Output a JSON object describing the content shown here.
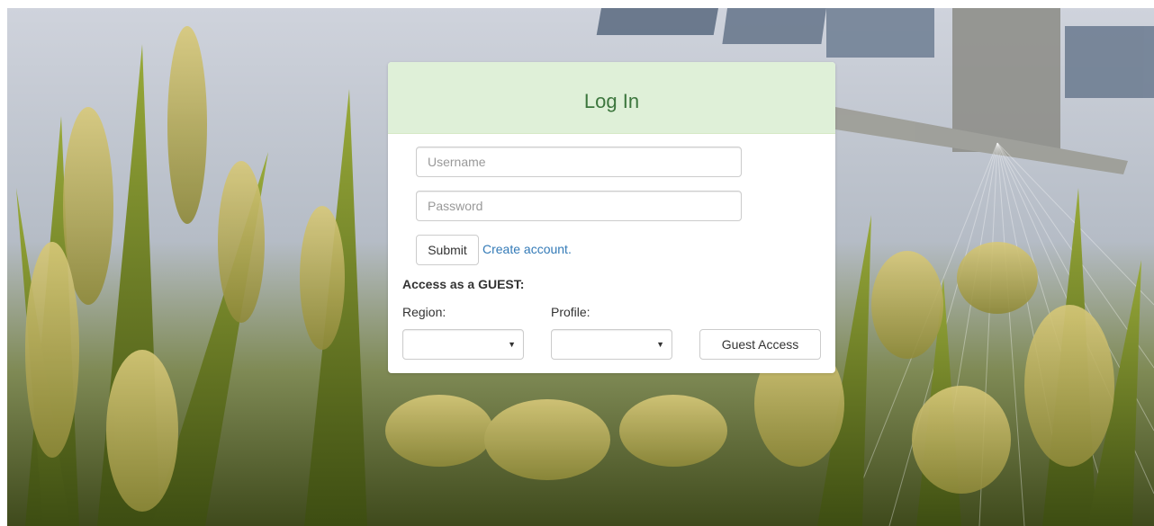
{
  "login": {
    "title": "Log In",
    "username_placeholder": "Username",
    "password_placeholder": "Password",
    "submit_label": "Submit",
    "create_account_label": "Create account."
  },
  "guest": {
    "heading": "Access as a GUEST:",
    "region_label": "Region:",
    "profile_label": "Profile:",
    "region_value": "",
    "profile_value": "",
    "button_label": "Guest Access"
  },
  "icons": {
    "select_caret": "chevron-down-icon"
  },
  "colors": {
    "header_bg": "#dff0d8",
    "title_text": "#3c763d",
    "link": "#337ab7"
  }
}
